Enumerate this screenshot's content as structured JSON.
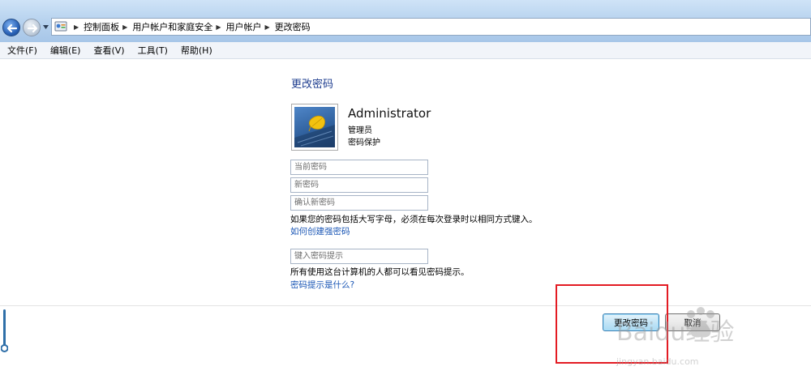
{
  "breadcrumb": [
    "控制面板",
    "用户帐户和家庭安全",
    "用户帐户",
    "更改密码"
  ],
  "menu": [
    "文件(F)",
    "编辑(E)",
    "查看(V)",
    "工具(T)",
    "帮助(H)"
  ],
  "page": {
    "heading": "更改密码",
    "user": {
      "name": "Administrator",
      "role": "管理员",
      "status": "密码保护"
    },
    "fields": {
      "current_password": {
        "placeholder": "当前密码",
        "value": ""
      },
      "new_password": {
        "placeholder": "新密码",
        "value": ""
      },
      "confirm_password": {
        "placeholder": "确认新密码",
        "value": ""
      },
      "password_hint": {
        "placeholder": "键入密码提示",
        "value": ""
      }
    },
    "case_note": "如果您的密码包括大写字母，必须在每次登录时以相同方式键入。",
    "strong_password_link": "如何创建强密码",
    "hint_note": "所有使用这台计算机的人都可以看见密码提示。",
    "hint_link": "密码提示是什么?"
  },
  "buttons": {
    "change_password": "更改密码",
    "cancel": "取消"
  },
  "watermark": {
    "brand": "Baidu经验",
    "url": "jingyan.baidu.com"
  },
  "icons": [
    "back-arrow-icon",
    "forward-arrow-icon",
    "control-panel-icon",
    "user-picture-icon",
    "breadcrumb-separator-icon"
  ],
  "colors": {
    "heading": "#1e3d8f",
    "link": "#1a56b5",
    "highlight": "#e31b23"
  }
}
